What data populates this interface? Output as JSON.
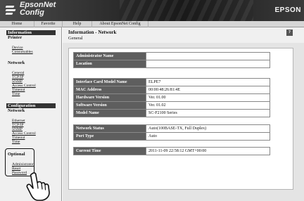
{
  "header": {
    "app_title": "EpsonNet\nConfig",
    "brand": "EPSON"
  },
  "menubar": [
    "Home",
    "Favorite",
    "Help",
    "About EpsonNet Config"
  ],
  "sidebar": {
    "information": {
      "title": "Information",
      "subtitle": "Printer",
      "printer_links": [
        "Device",
        "Consumables"
      ],
      "network_title": "Network",
      "network_links": [
        "General",
        "TCP/IP",
        "SNMP",
        "Access Control",
        "Timeout",
        "Time"
      ]
    },
    "configuration": {
      "title": "Configuration",
      "subtitle": "Network",
      "network_links": [
        "Ethernet",
        "TCP/IP",
        "SNMP",
        "Access Control",
        "Timeout",
        "Time"
      ]
    },
    "optional": {
      "title": "Optional",
      "links": [
        "Administrator",
        "Reset",
        "Password"
      ]
    }
  },
  "content": {
    "title": "Information - Network",
    "subtitle": "General",
    "help_icon_text": "?",
    "tables": [
      [
        {
          "label": "Administrator Name",
          "value": ""
        },
        {
          "label": "Location",
          "value": ""
        }
      ],
      [
        {
          "label": "Interface Card Model Name",
          "value": "ELPE7"
        },
        {
          "label": "MAC Address",
          "value": "00:00:48:26:81:4E"
        },
        {
          "label": "Hardware Version",
          "value": "Ver. 01.00"
        },
        {
          "label": "Software Version",
          "value": "Ver. 01.02"
        },
        {
          "label": "Model Name",
          "value": "SC-F2100 Series"
        }
      ],
      [
        {
          "label": "Network Status",
          "value": "Auto(100BASE-TX, Full Duplex)"
        },
        {
          "label": "Port Type",
          "value": "Auto"
        }
      ],
      [
        {
          "label": "Current Time",
          "value": "2011-11-09 22:58:12 GMT+00:00"
        }
      ]
    ]
  }
}
